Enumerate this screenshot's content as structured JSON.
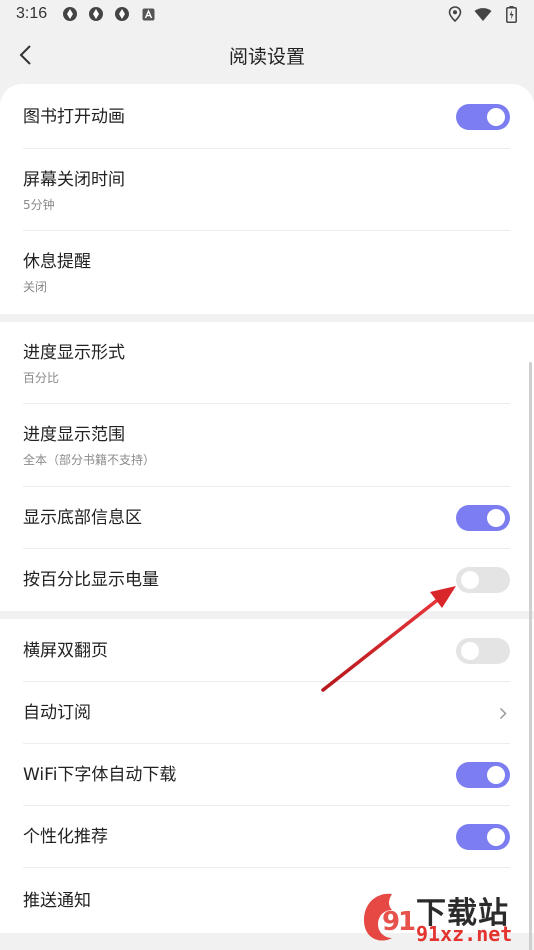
{
  "status_bar": {
    "time": "3:16",
    "left_icons": [
      "app-notification-icon",
      "app-notification-icon",
      "app-notification-icon",
      "a-badge-icon"
    ],
    "right_icons": [
      "location-icon",
      "wifi-icon",
      "battery-icon"
    ]
  },
  "header": {
    "title": "阅读设置",
    "back_icon": "chevron-left-icon"
  },
  "colors": {
    "accent": "#7b7df0",
    "toggle_off": "#e4e4e4",
    "background": "#f1f1f1",
    "arrow": "#d9262b"
  },
  "groups": [
    {
      "items": [
        {
          "label": "图书打开动画",
          "control": "toggle",
          "on": true
        },
        {
          "label": "屏幕关闭时间",
          "value": "5分钟"
        },
        {
          "label": "休息提醒",
          "value": "关闭"
        }
      ]
    },
    {
      "items": [
        {
          "label": "进度显示形式",
          "value": "百分比"
        },
        {
          "label": "进度显示范围",
          "value": "全本（部分书籍不支持）"
        },
        {
          "label": "显示底部信息区",
          "control": "toggle",
          "on": true
        },
        {
          "label": "按百分比显示电量",
          "control": "toggle",
          "on": false
        }
      ]
    },
    {
      "items": [
        {
          "label": "横屏双翻页",
          "control": "toggle",
          "on": false
        },
        {
          "label": "自动订阅",
          "control": "chevron"
        },
        {
          "label": "WiFi下字体自动下载",
          "control": "toggle",
          "on": true
        },
        {
          "label": "个性化推荐",
          "control": "toggle",
          "on": true
        },
        {
          "label": "推送通知"
        }
      ]
    }
  ],
  "watermark": {
    "text": "下载站",
    "url": "91xz.net"
  }
}
